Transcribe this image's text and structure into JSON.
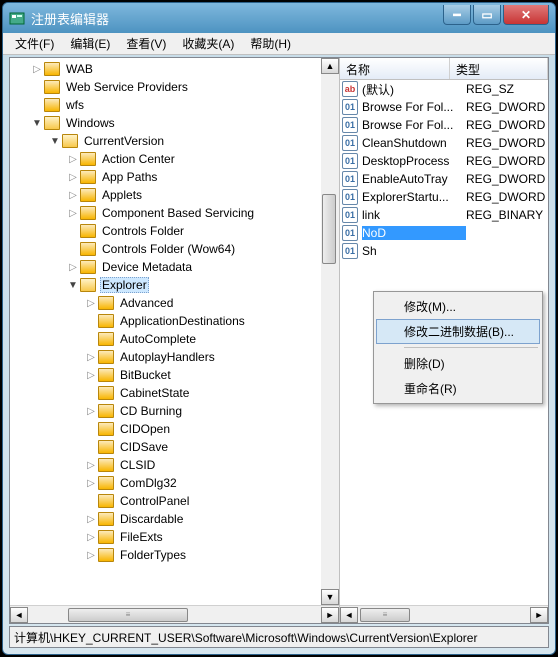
{
  "window": {
    "title": "注册表编辑器"
  },
  "menu": {
    "file": "文件(F)",
    "edit": "编辑(E)",
    "view": "查看(V)",
    "favorites": "收藏夹(A)",
    "help": "帮助(H)"
  },
  "tree": [
    {
      "indent": 1,
      "twisty": "▷",
      "label": "WAB"
    },
    {
      "indent": 1,
      "twisty": "",
      "label": "Web Service Providers"
    },
    {
      "indent": 1,
      "twisty": "",
      "label": "wfs"
    },
    {
      "indent": 1,
      "twisty": "▼",
      "open": true,
      "label": "Windows"
    },
    {
      "indent": 2,
      "twisty": "▼",
      "open": true,
      "label": "CurrentVersion"
    },
    {
      "indent": 3,
      "twisty": "▷",
      "label": "Action Center"
    },
    {
      "indent": 3,
      "twisty": "▷",
      "label": "App Paths"
    },
    {
      "indent": 3,
      "twisty": "▷",
      "label": "Applets"
    },
    {
      "indent": 3,
      "twisty": "▷",
      "label": "Component Based Servicing"
    },
    {
      "indent": 3,
      "twisty": "",
      "label": "Controls Folder"
    },
    {
      "indent": 3,
      "twisty": "",
      "label": "Controls Folder (Wow64)"
    },
    {
      "indent": 3,
      "twisty": "▷",
      "label": "Device Metadata"
    },
    {
      "indent": 3,
      "twisty": "▼",
      "open": true,
      "selected": true,
      "label": "Explorer"
    },
    {
      "indent": 4,
      "twisty": "▷",
      "label": "Advanced"
    },
    {
      "indent": 4,
      "twisty": "",
      "label": "ApplicationDestinations"
    },
    {
      "indent": 4,
      "twisty": "",
      "label": "AutoComplete"
    },
    {
      "indent": 4,
      "twisty": "▷",
      "label": "AutoplayHandlers"
    },
    {
      "indent": 4,
      "twisty": "▷",
      "label": "BitBucket"
    },
    {
      "indent": 4,
      "twisty": "",
      "label": "CabinetState"
    },
    {
      "indent": 4,
      "twisty": "▷",
      "label": "CD Burning"
    },
    {
      "indent": 4,
      "twisty": "",
      "label": "CIDOpen"
    },
    {
      "indent": 4,
      "twisty": "",
      "label": "CIDSave"
    },
    {
      "indent": 4,
      "twisty": "▷",
      "label": "CLSID"
    },
    {
      "indent": 4,
      "twisty": "▷",
      "label": "ComDlg32"
    },
    {
      "indent": 4,
      "twisty": "",
      "label": "ControlPanel"
    },
    {
      "indent": 4,
      "twisty": "▷",
      "label": "Discardable"
    },
    {
      "indent": 4,
      "twisty": "▷",
      "label": "FileExts"
    },
    {
      "indent": 4,
      "twisty": "▷",
      "label": "FolderTypes"
    }
  ],
  "listHeaders": {
    "name": "名称",
    "type": "类型"
  },
  "values": [
    {
      "icon": "str",
      "name": "(默认)",
      "type": "REG_SZ"
    },
    {
      "icon": "bin",
      "name": "Browse For Fol...",
      "type": "REG_DWORD"
    },
    {
      "icon": "bin",
      "name": "Browse For Fol...",
      "type": "REG_DWORD"
    },
    {
      "icon": "bin",
      "name": "CleanShutdown",
      "type": "REG_DWORD"
    },
    {
      "icon": "bin",
      "name": "DesktopProcess",
      "type": "REG_DWORD"
    },
    {
      "icon": "bin",
      "name": "EnableAutoTray",
      "type": "REG_DWORD"
    },
    {
      "icon": "bin",
      "name": "ExplorerStartu...",
      "type": "REG_DWORD"
    },
    {
      "icon": "bin",
      "name": "link",
      "type": "REG_BINARY"
    },
    {
      "icon": "bin",
      "name": "NoD",
      "type": "",
      "selected": true
    },
    {
      "icon": "bin",
      "name": "Sh",
      "type": ""
    }
  ],
  "context": {
    "modify": "修改(M)...",
    "modifyBinary": "修改二进制数据(B)...",
    "delete": "删除(D)",
    "rename": "重命名(R)"
  },
  "status": "计算机\\HKEY_CURRENT_USER\\Software\\Microsoft\\Windows\\CurrentVersion\\Explorer"
}
